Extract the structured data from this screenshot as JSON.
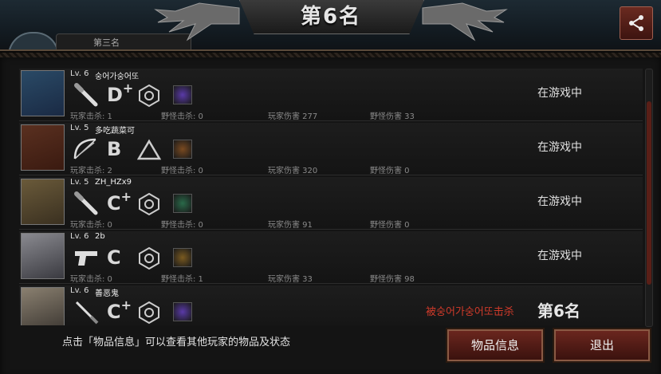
{
  "header": {
    "title": "第6名"
  },
  "left_tab": {
    "label": "第三名"
  },
  "players": [
    {
      "level": "Lv. 6",
      "name": "숭어가숭어또",
      "grade": "D",
      "grade_mod": "+",
      "weapon_icon": "bat-icon",
      "item_icon": "purple-creature-item-icon",
      "item_color": "#5a3aa8",
      "stats": {
        "player_kills": "玩家击杀: 1",
        "monster_kills": "野怪击杀: 0",
        "player_damage": "玩家伤害 277",
        "monster_damage": "野怪伤害 33"
      },
      "status": "在游戏中",
      "avatar_colors": [
        "#2a4a66",
        "#1a2a44"
      ]
    },
    {
      "level": "Lv. 5",
      "name": "多吃蔬菜可",
      "grade": "B",
      "grade_mod": "",
      "weapon_icon": "bow-icon",
      "item_icon": "orange-bundle-item-icon",
      "item_color": "#7a4a20",
      "stats": {
        "player_kills": "玩家击杀: 2",
        "monster_kills": "野怪击杀: 0",
        "player_damage": "玩家伤害 320",
        "monster_damage": "野怪伤害 0"
      },
      "status": "在游戏中",
      "avatar_colors": [
        "#5a3020",
        "#3a1a10"
      ]
    },
    {
      "level": "Lv. 5",
      "name": "ZH_HZx9",
      "grade": "C",
      "grade_mod": "+",
      "weapon_icon": "bat-icon",
      "item_icon": "green-herb-item-icon",
      "item_color": "#2a6a4a",
      "stats": {
        "player_kills": "玩家击杀: 0",
        "monster_kills": "野怪击杀: 0",
        "player_damage": "玩家伤害 91",
        "monster_damage": "野怪伤害 0"
      },
      "status": "在游戏中",
      "avatar_colors": [
        "#6a5a3a",
        "#3a3020"
      ]
    },
    {
      "level": "Lv. 6",
      "name": "2b",
      "grade": "C",
      "grade_mod": "",
      "weapon_icon": "pistol-icon",
      "item_icon": "gold-bundle-item-icon",
      "item_color": "#7a5a20",
      "stats": {
        "player_kills": "玩家击杀: 0",
        "monster_kills": "野怪击杀: 1",
        "player_damage": "玩家伤害 33",
        "monster_damage": "野怪伤害 98"
      },
      "status": "在游戏中",
      "avatar_colors": [
        "#8a8a90",
        "#3a3a40"
      ]
    },
    {
      "level": "Lv. 6",
      "name": "善恶鬼",
      "grade": "C",
      "grade_mod": "+",
      "weapon_icon": "knife-icon",
      "item_icon": "purple-creature-item-icon",
      "item_color": "#5a3aa8",
      "stats": {
        "player_kills": "",
        "monster_kills": "",
        "player_damage": "",
        "monster_damage": ""
      },
      "killed_by": "被숭어가숭어또击杀",
      "rank": "第6名",
      "avatar_colors": [
        "#8a8070",
        "#3a3530"
      ]
    }
  ],
  "footer": {
    "hint": "点击「物品信息」可以查看其他玩家的物品及状态"
  },
  "buttons": {
    "item_info": "物品信息",
    "exit": "退出"
  },
  "colors": {
    "accent_red": "#d03a2a",
    "button_red": "#6a261e",
    "scroll_thumb": "#5a1f17"
  }
}
